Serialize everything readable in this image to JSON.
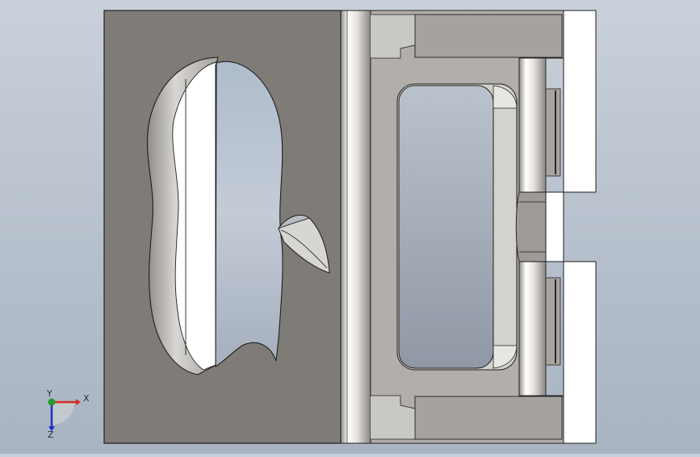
{
  "viewport": {
    "background_top": "#c9d0d9",
    "background_bottom": "#a9b4c2"
  },
  "model": {
    "face_color": "#7f7c77",
    "edge_color": "#202020",
    "highlight_color": "#ffffff",
    "mid_gray": "#aaa7a2",
    "light_gray": "#cfcdc8"
  },
  "triad": {
    "x_label": "X",
    "y_label": "Y",
    "z_label": "Z",
    "x_color": "#d42a1f",
    "y_color": "#1f9d2a",
    "z_color": "#1c2fc4"
  }
}
